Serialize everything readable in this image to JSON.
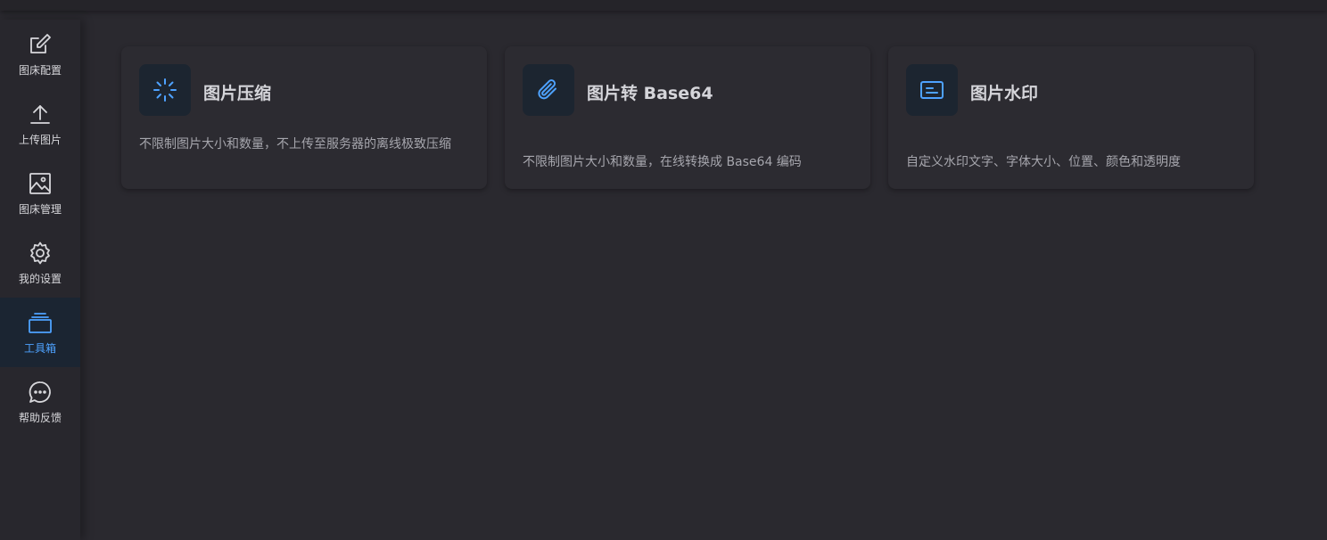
{
  "sidebar": {
    "items": [
      {
        "label": "图床配置",
        "icon": "edit-icon",
        "active": false
      },
      {
        "label": "上传图片",
        "icon": "upload-icon",
        "active": false
      },
      {
        "label": "图床管理",
        "icon": "image-icon",
        "active": false
      },
      {
        "label": "我的设置",
        "icon": "gear-icon",
        "active": false
      },
      {
        "label": "工具箱",
        "icon": "toolbox-icon",
        "active": true
      },
      {
        "label": "帮助反馈",
        "icon": "chat-icon",
        "active": false
      }
    ]
  },
  "tools": [
    {
      "title": "图片压缩",
      "description": "不限制图片大小和数量，不上传至服务器的离线极致压缩",
      "icon": "loading-spinner-icon"
    },
    {
      "title": "图片转 Base64",
      "description": "不限制图片大小和数量，在线转换成 Base64 编码",
      "icon": "paperclip-icon"
    },
    {
      "title": "图片水印",
      "description": "自定义水印文字、字体大小、位置、颜色和透明度",
      "icon": "watermark-card-icon"
    }
  ],
  "colors": {
    "background": "#2a292f",
    "sidebar": "#28272d",
    "accent": "#4ea2ff",
    "active_bg": "#1b2532",
    "text": "#d5d5da",
    "muted": "#a6a6ad"
  }
}
